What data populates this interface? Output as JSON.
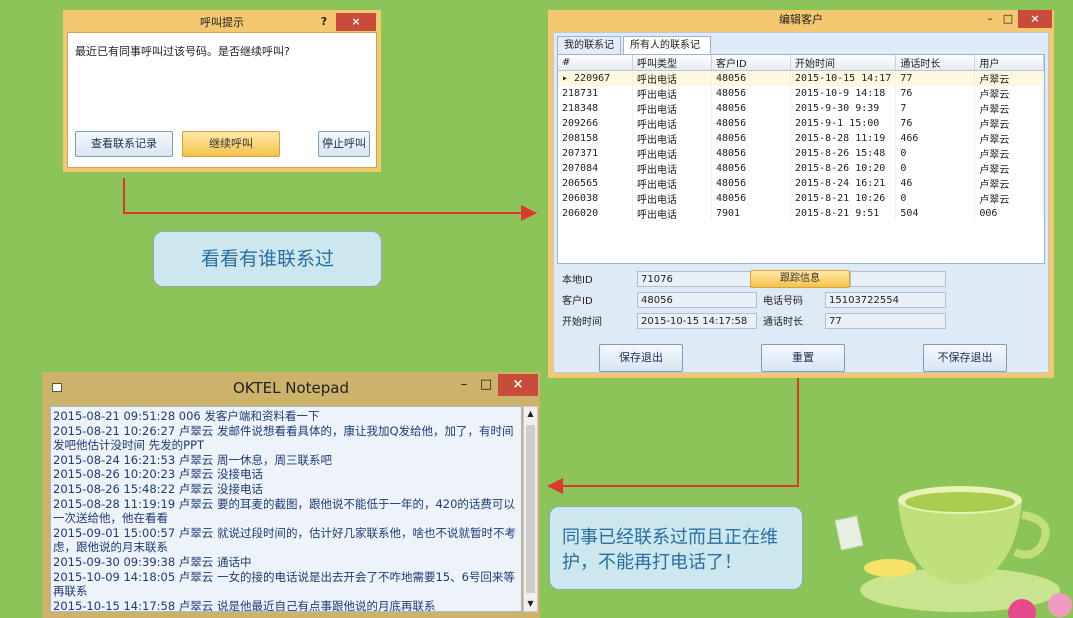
{
  "call_dialog": {
    "title": "呼叫提示",
    "help": "?",
    "close": "×",
    "message": "最近已有同事呼叫过该号码。是否继续呼叫?",
    "btn_view": "查看联系记录",
    "btn_continue": "继续呼叫",
    "btn_stop": "停止呼叫"
  },
  "edit_dialog": {
    "title": "编辑客户",
    "minimize": "–",
    "maximize": "□",
    "close": "×",
    "tabs": [
      "我的联系记录",
      "所有人的联系记录"
    ],
    "columns": [
      "#",
      "呼叫类型",
      "客户ID",
      "开始时间",
      "通话时长",
      "用户"
    ],
    "rows": [
      [
        "220967",
        "呼出电话",
        "48056",
        "2015-10-15 14:17",
        "77",
        "卢翠云"
      ],
      [
        "218731",
        "呼出电话",
        "48056",
        "2015-10-9 14:18",
        "76",
        "卢翠云"
      ],
      [
        "218348",
        "呼出电话",
        "48056",
        "2015-9-30 9:39",
        "7",
        "卢翠云"
      ],
      [
        "209266",
        "呼出电话",
        "48056",
        "2015-9-1 15:00",
        "76",
        "卢翠云"
      ],
      [
        "208158",
        "呼出电话",
        "48056",
        "2015-8-28 11:19",
        "466",
        "卢翠云"
      ],
      [
        "207371",
        "呼出电话",
        "48056",
        "2015-8-26 15:48",
        "0",
        "卢翠云"
      ],
      [
        "207084",
        "呼出电话",
        "48056",
        "2015-8-26 10:20",
        "0",
        "卢翠云"
      ],
      [
        "206565",
        "呼出电话",
        "48056",
        "2015-8-24 16:21",
        "46",
        "卢翠云"
      ],
      [
        "206038",
        "呼出电话",
        "48056",
        "2015-8-21 10:26",
        "0",
        "卢翠云"
      ],
      [
        "206020",
        "呼出电话",
        "7901",
        "2015-8-21 9:51",
        "504",
        "006"
      ]
    ],
    "form": {
      "local_id_label": "本地ID",
      "local_id": "71076",
      "customer_id_label": "客户ID",
      "customer_id": "48056",
      "start_label": "开始时间",
      "start": "2015-10-15 14:17:58",
      "track_btn": "跟踪信息",
      "phone_label": "电话号码",
      "phone": "15103722554",
      "duration_label": "通话时长",
      "duration": "77"
    },
    "btn_save": "保存退出",
    "btn_reset": "重置",
    "btn_nosave": "不保存退出"
  },
  "notepad": {
    "title": "OKTEL Notepad",
    "minimize": "–",
    "maximize": "□",
    "close": "×",
    "lines": [
      "2015-08-21 09:51:28  006  发客户端和资料看一下",
      "2015-08-21 10:26:27  卢翠云  发邮件说想看看具体的，康让我加Q发给他，加了，有时间发吧他估计没时间  先发的PPT",
      "2015-08-24 16:21:53  卢翠云  周一休息，周三联系吧",
      "2015-08-26 10:20:23  卢翠云  没接电话",
      "2015-08-26 15:48:22  卢翠云  没接电话",
      "2015-08-28 11:19:19  卢翠云  要的耳麦的截图，跟他说不能低于一年的，420的话费可以一次送给他，他在看看",
      "2015-09-01 15:00:57  卢翠云  就说过段时间的，估计好几家联系他，啥也不说就暂时不考虑，跟他说的月末联系",
      "2015-09-30 09:39:38  卢翠云  通话中",
      "2015-10-09 14:18:05  卢翠云  一女的接的电话说是出去开会了不咋地需要15、6号回来等再联系",
      "2015-10-15 14:17:58  卢翠云  说是他最近自己有点事跟他说的月底再联系"
    ]
  },
  "callouts": {
    "left": "看看有谁联系过",
    "right": "同事已经联系过而且正在维护，不能再打电话了！"
  },
  "colors": {
    "background": "#8dc45a",
    "arrow": "#d93a2b",
    "title_bar": "#f3c870"
  }
}
